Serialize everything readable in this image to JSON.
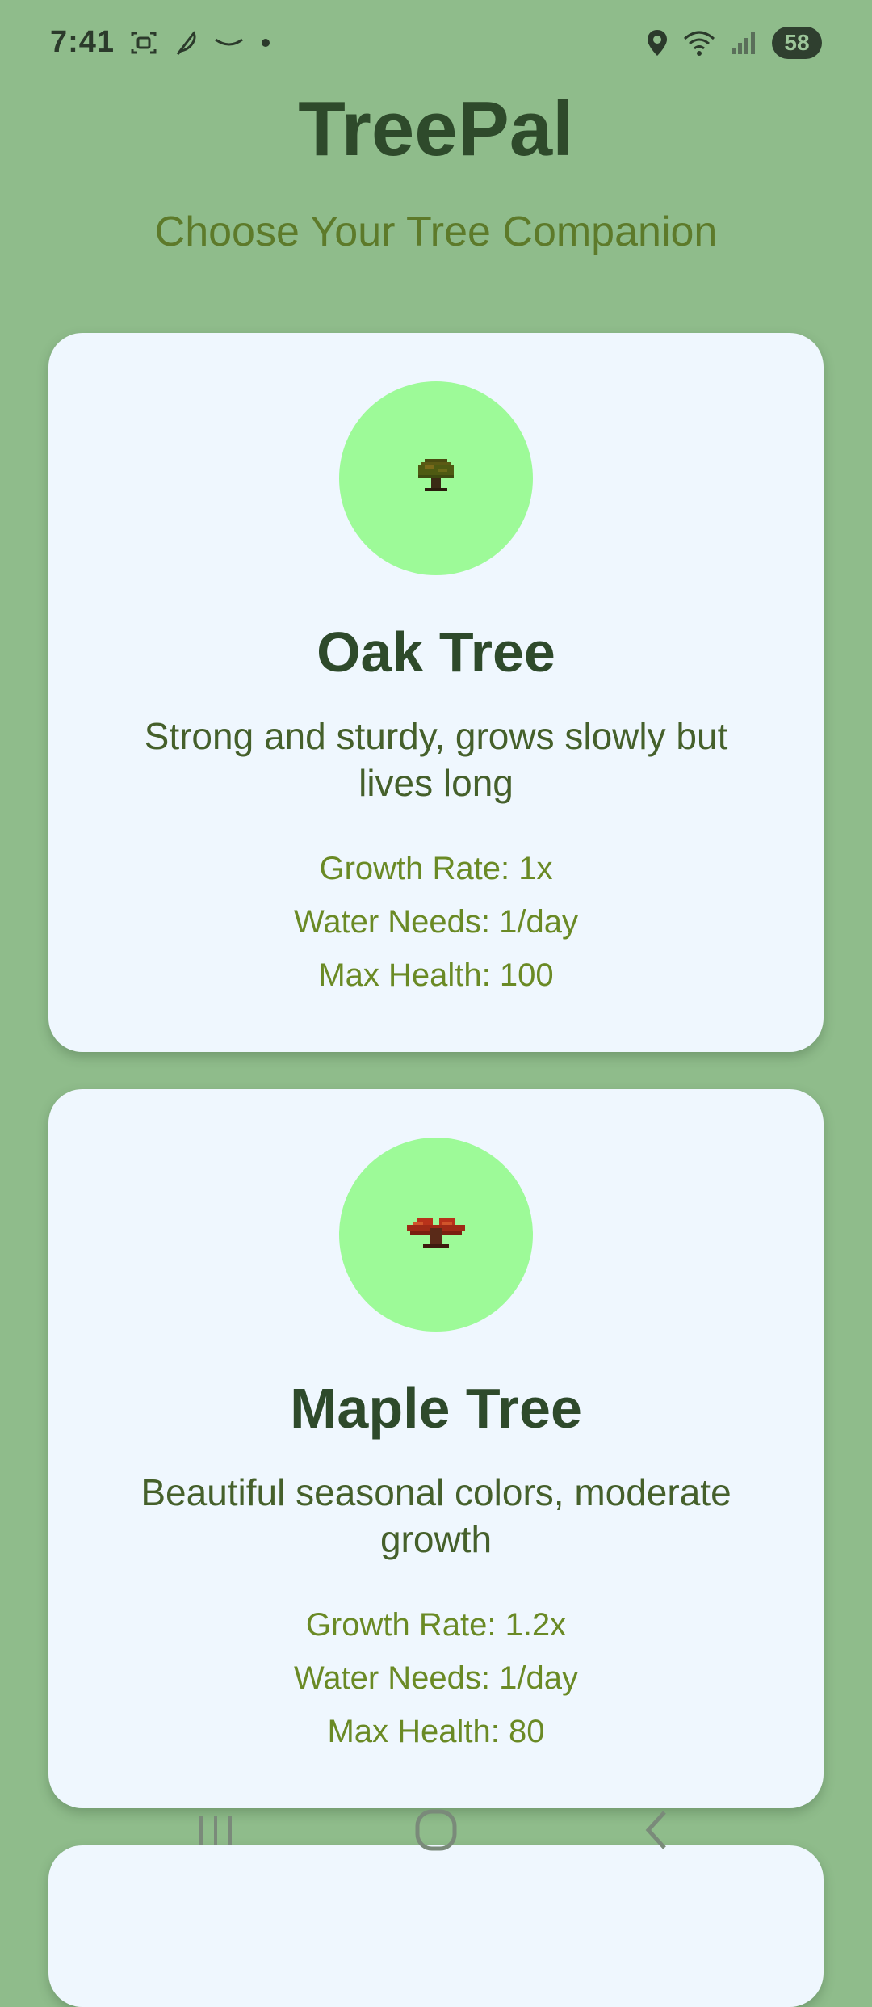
{
  "status_bar": {
    "time": "7:41",
    "battery": "58",
    "icons": [
      "screenshot-icon",
      "feather-icon",
      "amazon-smile-icon",
      "notification-dot-icon",
      "location-icon",
      "wifi-icon",
      "signal-icon",
      "battery-icon"
    ]
  },
  "header": {
    "title": "TreePal",
    "subtitle": "Choose Your Tree Companion"
  },
  "trees": [
    {
      "name": "Oak Tree",
      "description": "Strong and sturdy, grows slowly but lives long",
      "growth_rate": "Growth Rate: 1x",
      "water_needs": "Water Needs: 1/day",
      "max_health": "Max Health: 100",
      "icon": "oak-tree-icon"
    },
    {
      "name": "Maple Tree",
      "description": "Beautiful seasonal colors, moderate growth",
      "growth_rate": "Growth Rate: 1.2x",
      "water_needs": "Water Needs: 1/day",
      "max_health": "Max Health: 80",
      "icon": "maple-tree-icon"
    }
  ],
  "nav": {
    "icons": [
      "recent-apps-icon",
      "home-icon",
      "back-icon"
    ]
  },
  "colors": {
    "background": "#8fbc8b",
    "card": "#eff7fe",
    "circle": "#9dfa98",
    "title": "#2e4a2b",
    "subtitle": "#5d7a2a",
    "stat": "#6a8a25"
  }
}
